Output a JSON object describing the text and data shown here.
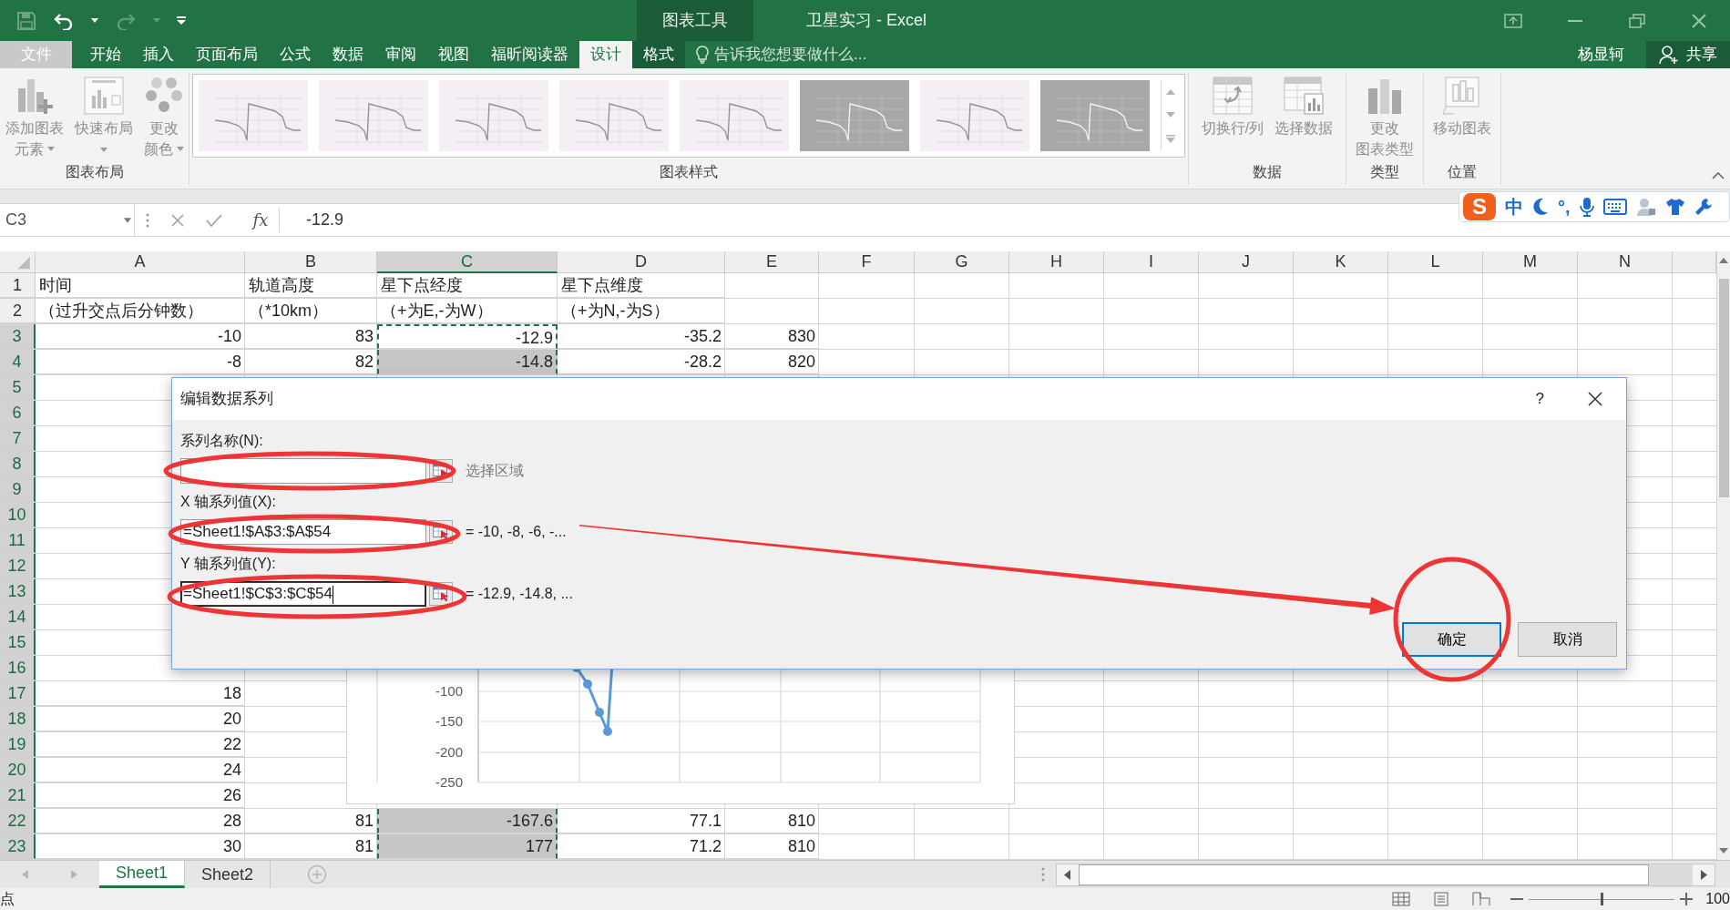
{
  "window": {
    "context_group": "图表工具",
    "title": "卫星实习 - Excel"
  },
  "ribbon_tabs": [
    {
      "label": "文件",
      "kind": "file",
      "selected": false
    },
    {
      "label": "开始",
      "kind": "normal",
      "selected": false
    },
    {
      "label": "插入",
      "kind": "normal",
      "selected": false
    },
    {
      "label": "页面布局",
      "kind": "normal",
      "selected": false
    },
    {
      "label": "公式",
      "kind": "normal",
      "selected": false
    },
    {
      "label": "数据",
      "kind": "normal",
      "selected": false
    },
    {
      "label": "审阅",
      "kind": "normal",
      "selected": false
    },
    {
      "label": "视图",
      "kind": "normal",
      "selected": false
    },
    {
      "label": "福昕阅读器",
      "kind": "normal",
      "selected": false
    },
    {
      "label": "设计",
      "kind": "context",
      "selected": true
    },
    {
      "label": "格式",
      "kind": "context",
      "selected": false
    }
  ],
  "tell_me": "告诉我您想要做什么...",
  "user": "杨显轲",
  "share": "共享",
  "ribbon_groups": [
    {
      "label": "图表布局",
      "kind": "buttons",
      "buttons": [
        {
          "kind": "add_element",
          "lines": [
            "添加图表",
            "元素"
          ],
          "dropdown": true,
          "disabled": true
        },
        {
          "kind": "quick_layout",
          "lines": [
            "快速布局"
          ],
          "dropdown": true,
          "disabled": true
        },
        {
          "kind": "colors",
          "lines": [
            "更改",
            "颜色"
          ],
          "dropdown": true,
          "disabled": true
        }
      ]
    },
    {
      "label": "图表样式",
      "kind": "gallery",
      "styles": [
        {
          "kind": "light"
        },
        {
          "kind": "light"
        },
        {
          "kind": "light"
        },
        {
          "kind": "light"
        },
        {
          "kind": "light"
        },
        {
          "kind": "dark"
        },
        {
          "kind": "light"
        },
        {
          "kind": "dark"
        }
      ]
    },
    {
      "label": "数据",
      "kind": "buttons",
      "buttons": [
        {
          "kind": "switch",
          "lines": [
            "切换行/列"
          ],
          "dropdown": false,
          "disabled": true
        },
        {
          "kind": "select_data",
          "lines": [
            "选择数据"
          ],
          "dropdown": false,
          "disabled": true
        }
      ]
    },
    {
      "label": "类型",
      "kind": "buttons",
      "buttons": [
        {
          "kind": "chart_type",
          "lines": [
            "更改",
            "图表类型"
          ],
          "dropdown": false,
          "disabled": true
        }
      ]
    },
    {
      "label": "位置",
      "kind": "buttons",
      "buttons": [
        {
          "kind": "move_chart",
          "lines": [
            "移动图表"
          ],
          "dropdown": false,
          "disabled": true
        }
      ]
    }
  ],
  "ime_toolbar": [
    {
      "kind": "logo",
      "label": "S"
    },
    {
      "kind": "text",
      "label": "中"
    },
    {
      "kind": "moon"
    },
    {
      "kind": "text",
      "label": "°,"
    },
    {
      "kind": "mic"
    },
    {
      "kind": "keyboard"
    },
    {
      "kind": "person"
    },
    {
      "kind": "shirt"
    },
    {
      "kind": "wrench"
    }
  ],
  "formula_bar": {
    "name_box": "C3",
    "fx": "fx",
    "value": "-12.9"
  },
  "columns": [
    {
      "label": "A",
      "selected": false
    },
    {
      "label": "B",
      "selected": false
    },
    {
      "label": "C",
      "selected": true
    },
    {
      "label": "D",
      "selected": false
    },
    {
      "label": "E",
      "selected": false
    },
    {
      "label": "F",
      "selected": false
    },
    {
      "label": "G",
      "selected": false
    },
    {
      "label": "H",
      "selected": false
    },
    {
      "label": "I",
      "selected": false
    },
    {
      "label": "J",
      "selected": false
    },
    {
      "label": "K",
      "selected": false
    },
    {
      "label": "L",
      "selected": false
    },
    {
      "label": "M",
      "selected": false
    },
    {
      "label": "N",
      "selected": false
    }
  ],
  "rows": [
    {
      "label": "1",
      "kind": "text",
      "selected": false,
      "cells": {
        "A": "时间",
        "B": "轨道高度",
        "C": "星下点经度",
        "D": "星下点维度"
      }
    },
    {
      "label": "2",
      "kind": "text",
      "selected": false,
      "cells": {
        "A": "（过升交点后分钟数）",
        "B": "（*10km）",
        "C": "（+为E,-为W）",
        "D": "（+为N,-为S）"
      }
    },
    {
      "label": "3",
      "kind": "number",
      "selected": true,
      "cells": {
        "A": "-10",
        "B": "83",
        "C": "-12.9",
        "D": "-35.2",
        "E": "830"
      }
    },
    {
      "label": "4",
      "kind": "number",
      "selected": true,
      "cells": {
        "A": "-8",
        "B": "82",
        "C": "-14.8",
        "D": "-28.2",
        "E": "820"
      }
    },
    {
      "label": "5",
      "kind": "number",
      "selected": true
    },
    {
      "label": "6",
      "kind": "number",
      "selected": true
    },
    {
      "label": "7",
      "kind": "number",
      "selected": true
    },
    {
      "label": "8",
      "kind": "number",
      "selected": true
    },
    {
      "label": "9",
      "kind": "number",
      "selected": true
    },
    {
      "label": "10",
      "kind": "number",
      "selected": true
    },
    {
      "label": "11",
      "kind": "number",
      "selected": true
    },
    {
      "label": "12",
      "kind": "number",
      "selected": true
    },
    {
      "label": "13",
      "kind": "number",
      "selected": true
    },
    {
      "label": "14",
      "kind": "number",
      "selected": true
    },
    {
      "label": "15",
      "kind": "number",
      "selected": true
    },
    {
      "label": "16",
      "kind": "number",
      "selected": true
    },
    {
      "label": "17",
      "kind": "number",
      "selected": true,
      "cells": {
        "A": "18"
      }
    },
    {
      "label": "18",
      "kind": "number",
      "selected": true,
      "cells": {
        "A": "20"
      }
    },
    {
      "label": "19",
      "kind": "number",
      "selected": true,
      "cells": {
        "A": "22"
      }
    },
    {
      "label": "20",
      "kind": "number",
      "selected": true,
      "cells": {
        "A": "24"
      }
    },
    {
      "label": "21",
      "kind": "number",
      "selected": true,
      "cells": {
        "A": "26"
      }
    },
    {
      "label": "22",
      "kind": "number",
      "selected": true,
      "cells": {
        "A": "28",
        "B": "81",
        "C": "-167.6",
        "D": "77.1",
        "E": "810"
      }
    },
    {
      "label": "23",
      "kind": "number",
      "selected": true,
      "cells": {
        "A": "30",
        "B": "81",
        "C": "177",
        "D": "71.2",
        "E": "810"
      }
    }
  ],
  "chart": {
    "y_tick_labels": [
      "-100",
      "-150",
      "-200",
      "-250"
    ]
  },
  "dialog": {
    "title": "编辑数据系列",
    "help": "?",
    "fields": [
      {
        "label": "系列名称(N):",
        "note": "选择区域",
        "kind": "hint",
        "focused": false
      },
      {
        "label": "X 轴系列值(X):",
        "value": "=Sheet1!$A$3:$A$54",
        "note": "= -10, -8, -6, -...",
        "kind": "preview",
        "focused": false
      },
      {
        "label": "Y 轴系列值(Y):",
        "value": "=Sheet1!$C$3:$C$54",
        "note": "= -12.9, -14.8, ...",
        "kind": "preview",
        "focused": true
      }
    ],
    "buttons": [
      {
        "label": "确定",
        "default": true
      },
      {
        "label": "取消",
        "default": false
      }
    ]
  },
  "sheet_tabs": [
    {
      "label": "Sheet1",
      "selected": true
    },
    {
      "label": "Sheet2",
      "selected": false
    }
  ],
  "status_bar": {
    "text": "点",
    "zoom": "100",
    "zoom_slider": {
      "level": 0.5
    }
  }
}
